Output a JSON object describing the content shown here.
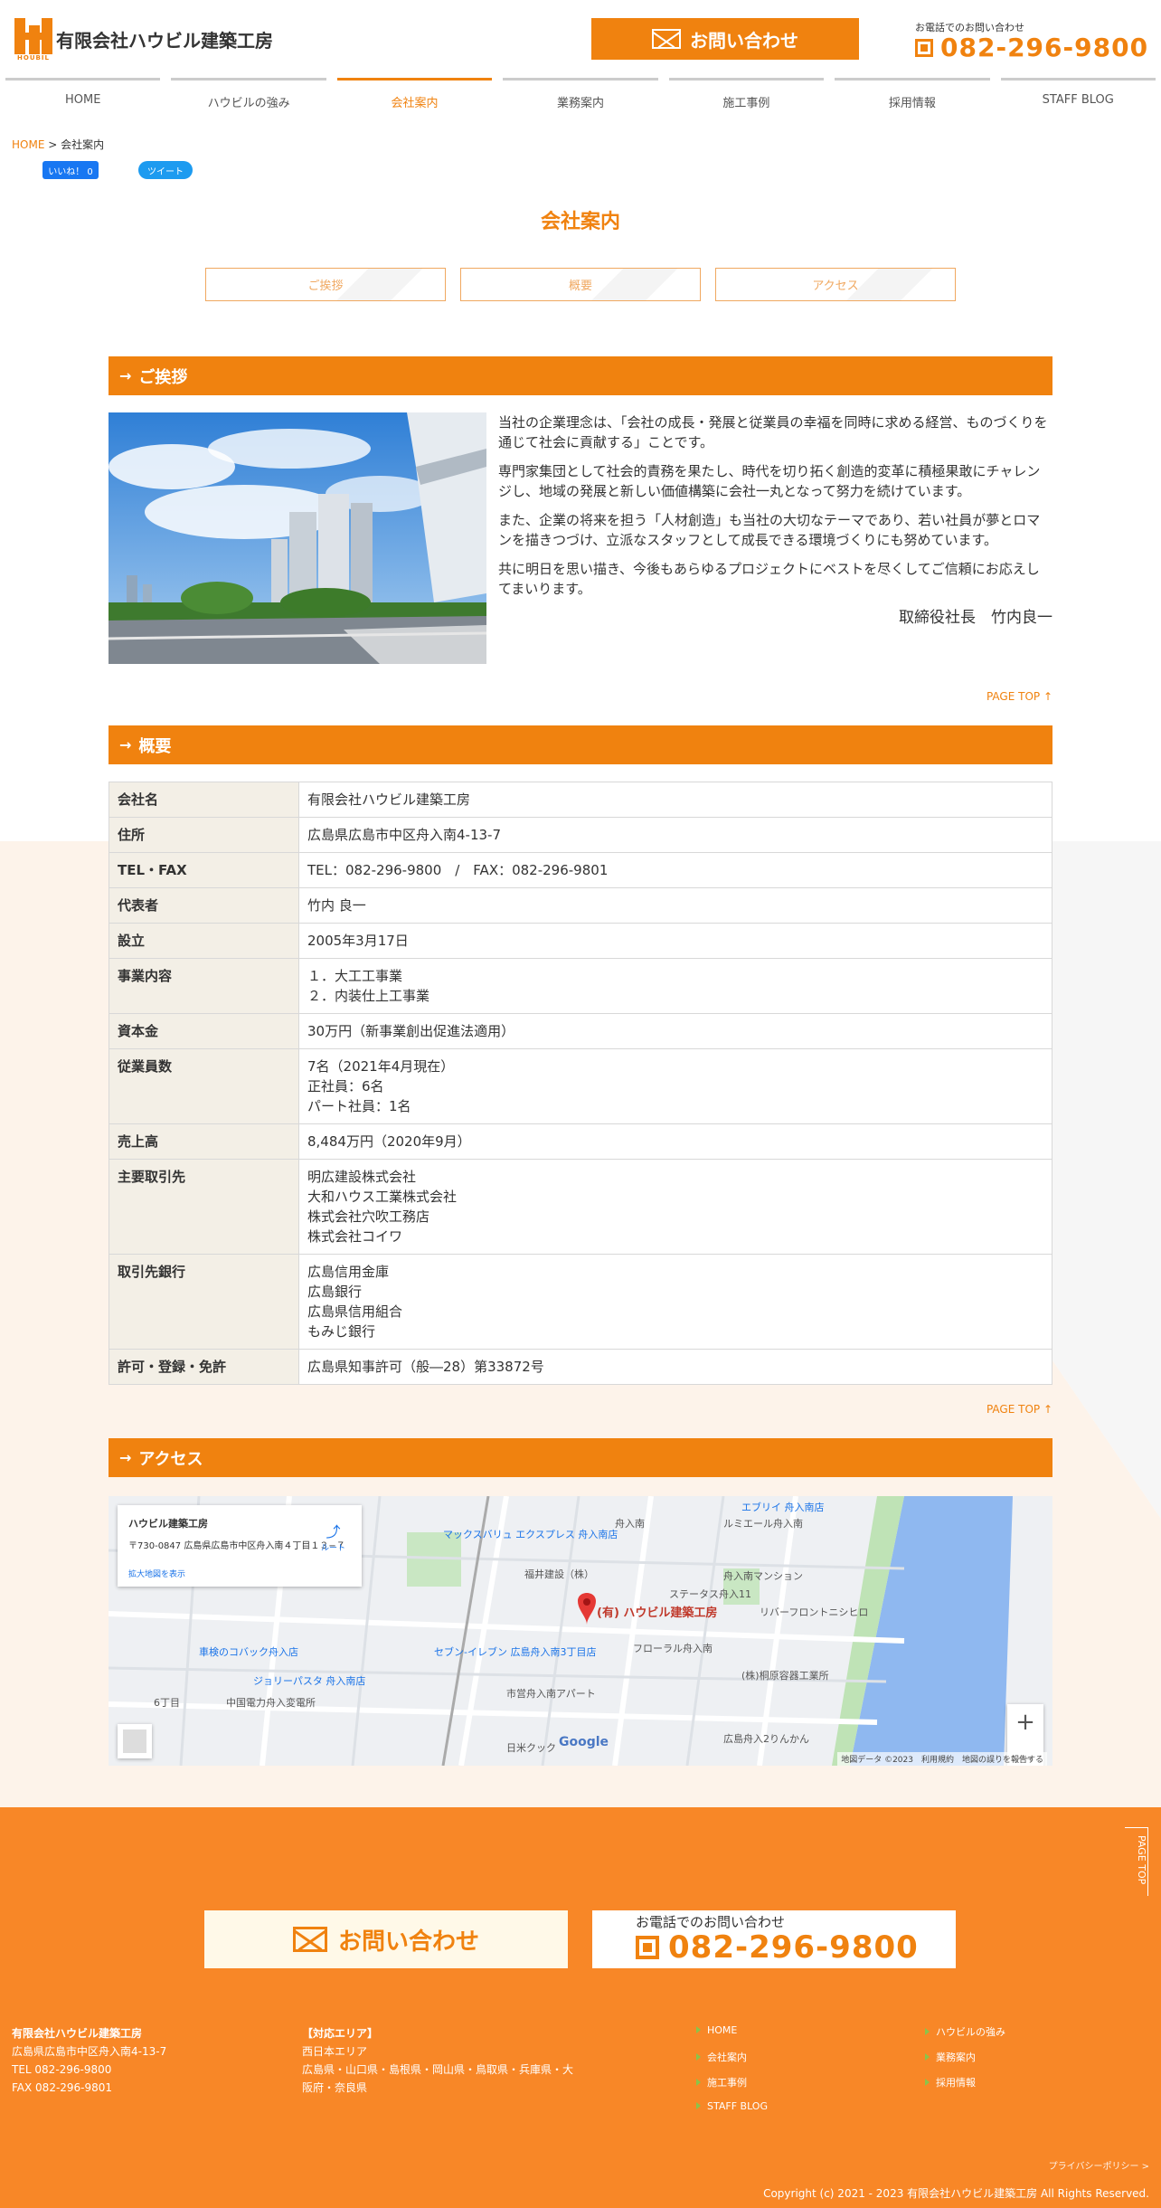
{
  "header": {
    "logo_text": "有限会社ハウビル建築工房",
    "logo_sub": "HOUBIL",
    "contact_label": "お問い合わせ",
    "tel_label": "お電話でのお問い合わせ",
    "tel_number": "082-296-9800"
  },
  "nav": [
    "HOME",
    "ハウビルの強み",
    "会社案内",
    "業務案内",
    "施工事例",
    "採用情報",
    "STAFF BLOG"
  ],
  "breadcrumb": {
    "home": "HOME",
    "sep": " > ",
    "current": "会社案内"
  },
  "social": {
    "fb": "いいね！ 0",
    "tw": "ツイート"
  },
  "page_title": "会社案内",
  "anchor_tabs": [
    "ご挨拶",
    "概要",
    "アクセス"
  ],
  "greeting": {
    "heading": "ご挨拶",
    "paragraphs": [
      "当社の企業理念は、「会社の成長・発展と従業員の幸福を同時に求める経営、ものづくりを通じて社会に貢献する」ことです。",
      "専門家集団として社会的責務を果たし、時代を切り拓く創造的変革に積極果敢にチャレンジし、地域の発展と新しい価値構築に会社一丸となって努力を続けています。",
      "また、企業の将来を担う「人材創造」も当社の大切なテーマであり、若い社員が夢とロマンを描きつづけ、立派なスタッフとして成長できる環境づくりにも努めています。",
      "共に明日を思い描き、今後もあらゆるプロジェクトにベストを尽くしてご信頼にお応えしてまいります。"
    ],
    "signature": "取締役社長　竹内良一"
  },
  "page_top": "PAGE TOP ↑",
  "overview": {
    "heading": "概要",
    "rows": [
      {
        "label": "会社名",
        "value": "有限会社ハウビル建築工房"
      },
      {
        "label": "住所",
        "value": "広島県広島市中区舟入南4-13-7"
      },
      {
        "label": "TEL・FAX",
        "value": "TEL：082-296-9800　/　FAX：082-296-9801"
      },
      {
        "label": "代表者",
        "value": "竹内 良一"
      },
      {
        "label": "設立",
        "value": "2005年3月17日"
      },
      {
        "label": "事業内容",
        "value": "１．大工工事業\n２．内装仕上工事業"
      },
      {
        "label": "資本金",
        "value": "30万円（新事業創出促進法適用）"
      },
      {
        "label": "従業員数",
        "value": "7名（2021年4月現在）\n正社員：6名\nパート社員：1名"
      },
      {
        "label": "売上高",
        "value": "8,484万円（2020年9月）"
      },
      {
        "label": "主要取引先",
        "value": "明広建設株式会社\n大和ハウス工業株式会社\n株式会社穴吹工務店\n株式会社コイワ"
      },
      {
        "label": "取引先銀行",
        "value": "広島信用金庫\n広島銀行\n広島県信用組合\nもみじ銀行"
      },
      {
        "label": "許可・登録・免許",
        "value": "広島県知事許可（般―28）第33872号"
      }
    ]
  },
  "access": {
    "heading": "アクセス",
    "map_info_title": "ハウビル建築工房",
    "map_info_addr": "〒730-0847 広島県広島市中区舟入南４丁目１３−７",
    "map_info_link": "拡大地図を表示",
    "map_dir": "ルート",
    "marker_label": "(有) ハウビル建築工房",
    "map_places": [
      "エブリイ 舟入南店",
      "マックスバリュ エクスプレス 舟入南店",
      "福井建設（株）",
      "舟入南",
      "ルミエール舟入南",
      "フローラル舟入南",
      "セブン-イレブン 広島舟入南3丁目店",
      "車検のコバック舟入店",
      "ジョリーパスタ 舟入南店",
      "リバーフロントニシヒロ",
      "(株)桐原容器工業所",
      "広島舟入2りんかん",
      "ステータス舟入11",
      "舟入南マンション",
      "市営舟入南アパート",
      "中国電力舟入変電所",
      "6丁目",
      "日米クック"
    ],
    "map_attrib": "地図データ ©2023　利用規約　地図の誤りを報告する",
    "map_logo": "Google",
    "zoom_in": "+",
    "zoom_out": "−"
  },
  "footer": {
    "contact_label": "お問い合わせ",
    "tel_label": "お電話でのお問い合わせ",
    "tel_number": "082-296-9800",
    "page_top": "PAGE TOP",
    "company_name": "有限会社ハウビル建築工房",
    "company_addr": "広島県広島市中区舟入南4-13-7",
    "company_tel": "TEL 082-296-9800",
    "company_fax": "FAX 082-296-9801",
    "area_title": "【対応エリア】",
    "area_1": "西日本エリア",
    "area_2": "広島県・山口県・島根県・岡山県・鳥取県・兵庫県・大阪府・奈良県",
    "links": [
      "HOME",
      "ハウビルの強み",
      "会社案内",
      "業務案内",
      "施工事例",
      "採用情報",
      "STAFF BLOG"
    ],
    "privacy": "プライバシーポリシー >",
    "copyright": "Copyright (c) 2021 - 2023 有限会社ハウビル建築工房 All Rights Reserved."
  },
  "colors": {
    "accent": "#f0820f",
    "footer_bg": "#f88727",
    "table_head": "#f3efe6"
  }
}
